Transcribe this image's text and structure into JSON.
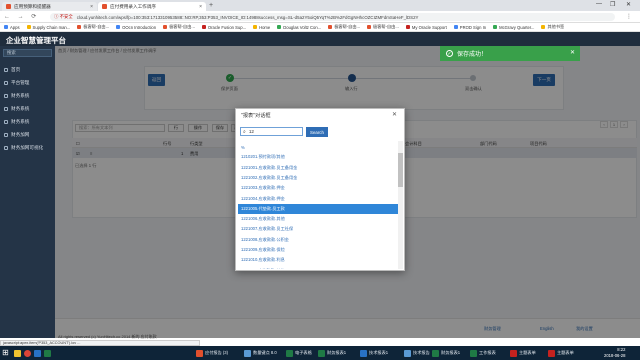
{
  "browser": {
    "tabs": [
      {
        "label": "应用预算和提醒器"
      },
      {
        "label": "应付费用录入工作调序"
      }
    ],
    "new_tab": "+",
    "window_controls": [
      "—",
      "❐",
      "✕"
    ],
    "nav": "← → ⟳",
    "not_secure": "ⓘ 不安全",
    "url": "cloud.yunhitech.com/wps/fp=100:353:1713310953588::NO:RP,353:P353_INVOICE_ID:14988success_msg=SL-d5a2Y5oiQ5YqT%2B%2FdGgNHhcOZCIZMFdmSaHeF_lDS2Y",
    "menu": "⋮",
    "bookmarks": [
      "Apps",
      "Supply Chain man...",
      "极客帮-自由...",
      "OOcn Introduction",
      "极客帮-自由...",
      "Oracle Fusion Sup...",
      "Home",
      "Douglas Voltz Con...",
      "极客帮-自由...",
      "极客帮-自由...",
      "My Oracle Support",
      "PROD Sign In",
      "McGravy Quarter...",
      "其他书签"
    ]
  },
  "app": {
    "title": "企业智慧管理平台",
    "sidebar_search": "搜索",
    "sidebar": [
      "首页",
      "平台管理",
      "财务系统",
      "财务系统",
      "财务系统",
      "财务加网",
      "财务加网可视化"
    ],
    "breadcrumb": "首页  /  财务管理  /  应付发票工作台  /  应付发票工作调序"
  },
  "steps": {
    "prev_label": "返回",
    "next_label": "下一页",
    "items": [
      {
        "label": "保护页面",
        "mark": "✓"
      },
      {
        "label": "输入行",
        "mark": ""
      },
      {
        "label": "双击确认",
        "mark": ""
      }
    ]
  },
  "grid": {
    "search_placeholder": "搜索：所有文本列",
    "toolbar": [
      "行",
      "操作",
      "保存",
      "添加行",
      "删除"
    ],
    "headers": [
      "行号",
      "行类型",
      "金额",
      "会计科目",
      "部门代码",
      "项目代码"
    ],
    "row": {
      "no": "1",
      "type": "费用"
    },
    "footer": "已选择 1 行",
    "pager": [
      "1"
    ]
  },
  "dialog": {
    "title": "\"报表\"对话框",
    "close": "✕",
    "search_value": "12",
    "search_button": "Search",
    "items": [
      "%",
      "1210201.预付款项/其他",
      "1221001.应收款款.员工备用金",
      "1221002.应收款款.员工备用金",
      "1221003.应收款款.押金",
      "1221004.应收款款.押金",
      "1221005.代垫款.员工款",
      "1221006.应收款款.其他",
      "1221007.应收款款.员工社保",
      "1221008.应收款款.公积金",
      "1221009.应收款款.保险",
      "1221010.应收款款.利息",
      "1221011.应收款款.其他"
    ],
    "selected_index": 6
  },
  "toast": {
    "check": "✓",
    "message": "保存成功！",
    "close": "✕"
  },
  "footer": {
    "links": [
      "财务管理",
      "English",
      "我的设置"
    ],
    "copyright": "All rights reserved (c) YunHitech.co 2014  新的 应付账款"
  },
  "status_url": "javascript:apex.item('P353_ACCOUNT').lov ...",
  "taskbar": {
    "start": "⊞",
    "items": [
      "应付报告 (3)",
      "数量键点 8.0",
      "电子表格",
      "财务报表1",
      "技术报表1",
      "技术报告",
      "财务报表1",
      "工作报表",
      "主题表单",
      "主题表单"
    ],
    "time": "8:22",
    "date": "2018-06-28"
  },
  "colors": {
    "primary": "#2f6db5",
    "success": "#39a04a",
    "sidebar": "#243447"
  }
}
